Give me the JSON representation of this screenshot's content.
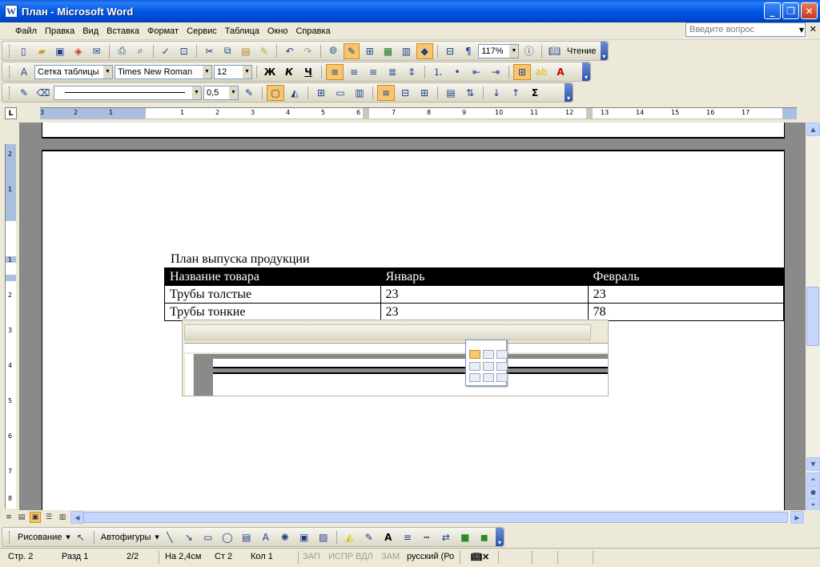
{
  "window": {
    "title": "План - Microsoft Word",
    "app_icon": "W"
  },
  "menu": [
    "Файл",
    "Правка",
    "Вид",
    "Вставка",
    "Формат",
    "Сервис",
    "Таблица",
    "Окно",
    "Справка"
  ],
  "ask": {
    "placeholder": "Введите вопрос"
  },
  "standard_toolbar": {
    "zoom": "117%",
    "read_label": "Чтение"
  },
  "formatting_toolbar": {
    "style": "Сетка таблицы",
    "font": "Times New Roman",
    "size": "12",
    "bold": "Ж",
    "italic": "К",
    "underline": "Ч"
  },
  "tables_toolbar": {
    "line_weight": "0,5",
    "sum": "Σ"
  },
  "ruler": {
    "numbers": [
      "3",
      "2",
      "1",
      "1",
      "2",
      "3",
      "4",
      "5",
      "6",
      "7",
      "8",
      "9",
      "10",
      "11",
      "12",
      "13",
      "14",
      "15",
      "16",
      "17"
    ]
  },
  "vruler": {
    "numbers": [
      "2",
      "1",
      "1",
      "2",
      "3",
      "4",
      "5",
      "6",
      "7",
      "8",
      "9"
    ]
  },
  "document": {
    "heading": "План выпуска продукции",
    "table": {
      "headers": [
        "Название товара",
        "Январь",
        "Февраль"
      ],
      "rows": [
        [
          "Трубы толстые",
          "23",
          "23"
        ],
        [
          "Трубы тонкие",
          "23",
          "78"
        ]
      ]
    }
  },
  "drawing_toolbar": {
    "draw_label": "Рисование",
    "autoshapes_label": "Автофигуры"
  },
  "status": {
    "page": "Стр. 2",
    "section": "Разд 1",
    "pages": "2/2",
    "at": "На 2,4см",
    "line": "Ст 2",
    "col": "Кол 1",
    "rec": "ЗАП",
    "trk": "ИСПР",
    "ext": "ВДЛ",
    "ovr": "ЗАМ",
    "lang": "русский (Ро"
  },
  "colors": {
    "title_bar": "#0058e6",
    "accent_active": "#f6c66e",
    "page_bg": "#8a8a8a"
  }
}
